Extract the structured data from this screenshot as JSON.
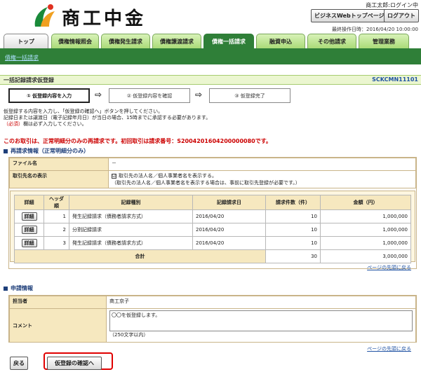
{
  "header": {
    "logo_text": "商工中金",
    "user": "商工太郎:ログイン中",
    "top_page_button": "ビジネスWebトップページへ",
    "logout_button": "ログアウト",
    "last_operation": "最終操作日時：2016/04/20 10:00:00"
  },
  "tabs": [
    {
      "label": "トップ",
      "active": false
    },
    {
      "label": "債権情報照会",
      "active": false
    },
    {
      "label": "債権発生請求",
      "active": false
    },
    {
      "label": "債権譲渡請求",
      "active": false
    },
    {
      "label": "債権一括請求",
      "active": true
    },
    {
      "label": "融資申込",
      "active": false
    },
    {
      "label": "その他請求",
      "active": false
    },
    {
      "label": "管理業務",
      "active": false
    }
  ],
  "subnav": {
    "link": "債権一括請求"
  },
  "page": {
    "title": "一括記録請求仮登録",
    "screen_id": "SCKCMN11101"
  },
  "steps": [
    "① 仮登録内容を入力",
    "② 仮登録内容を確認",
    "③ 仮登録完了"
  ],
  "step_arrow": "⇨",
  "instructions": {
    "line1": "仮登録する内容を入力し、「仮登録の確認へ」ボタンを押してください。",
    "line2": "記録日または譲渡日（電子記録年月日）が当日の場合、15時までに承認する必要があります。",
    "line3_req": "（必須）",
    "line3_rest": "欄は必ず入力してください。"
  },
  "notice": "このお取引は、正常明細分のみの再請求です。初回取引は請求番号：S2004201604200000080です。",
  "resubmit": {
    "section_title": "再請求情報（正常明細分のみ）",
    "file_name_label": "ファイル名",
    "file_name_value": "－",
    "display_label": "取引先名の表示",
    "display_check": "☑",
    "display_line1": "取引先の法人名／個人事業者名を表示する。",
    "display_line2": "（取引先の法人名／個人事業者名を表示する場合は、事前に取引先登録が必要です。）"
  },
  "table": {
    "headers": [
      "詳細",
      "ヘッダ順",
      "記録種別",
      "記録請求日",
      "請求件数（件）",
      "金額（円）"
    ],
    "detail_label": "詳細",
    "rows": [
      {
        "order": "1",
        "type": "発生記録請求（債務者請求方式）",
        "date": "2016/04/20",
        "count": "10",
        "amount": "1,000,000"
      },
      {
        "order": "2",
        "type": "分割記録請求",
        "date": "2016/04/20",
        "count": "10",
        "amount": "1,000,000"
      },
      {
        "order": "3",
        "type": "発生記録請求（債務者請求方式）",
        "date": "2016/04/20",
        "count": "10",
        "amount": "1,000,000"
      }
    ],
    "total_label": "合計",
    "total_count": "30",
    "total_amount": "3,000,000"
  },
  "page_top_link": "ページの先頭に戻る",
  "application": {
    "section_title": "申請情報",
    "person_label": "担当者",
    "person_value": "商工京子",
    "comment_label": "コメント",
    "comment_value": "〇〇を仮登録します。",
    "comment_hint": "（250文字以内）"
  },
  "footer": {
    "back_button": "戻る",
    "confirm_button": "仮登録の確認へ"
  }
}
